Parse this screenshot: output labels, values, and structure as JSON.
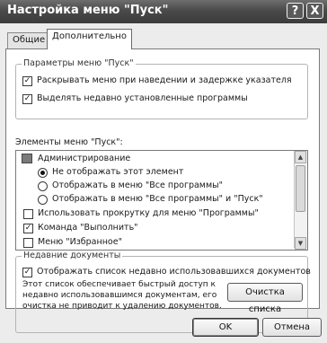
{
  "window": {
    "title": "Настройка меню \"Пуск\"",
    "help_label": "?",
    "close_label": "X"
  },
  "tabs": [
    {
      "label": "Общие"
    },
    {
      "label": "Дополнительно"
    }
  ],
  "start_menu_params": {
    "label": "Параметры меню \"Пуск\"",
    "options": [
      {
        "label": "Раскрывать меню при наведении и задержке указателя",
        "checked": true
      },
      {
        "label": "Выделять недавно установленные программы",
        "checked": true
      }
    ]
  },
  "elements": {
    "label": "Элементы меню \"Пуск\":",
    "group_header": "Администрирование",
    "radio_options": [
      {
        "label": "Не отображать этот элемент",
        "selected": true
      },
      {
        "label": "Отображать в меню \"Все программы\"",
        "selected": false
      },
      {
        "label": "Отображать в меню \"Все программы\" и \"Пуск\"",
        "selected": false
      }
    ],
    "check_items": [
      {
        "label": "Использовать прокрутку для меню \"Программы\"",
        "checked": false
      },
      {
        "label": "Команда \"Выполнить\"",
        "checked": true
      },
      {
        "label": "Меню \"Избранное\"",
        "checked": false
      }
    ]
  },
  "recent_docs": {
    "label": "Недавние документы",
    "option": {
      "label": "Отображать список недавно использовавшихся документов",
      "checked": true
    },
    "description": "Этот список обеспечивает быстрый доступ к\nнедавно использовавшимся документам, его\nочистка не приводит к удалению документов.",
    "clear_button": "Очистка списка"
  },
  "footer": {
    "ok_label": "OK",
    "cancel_label": "Отмена"
  }
}
